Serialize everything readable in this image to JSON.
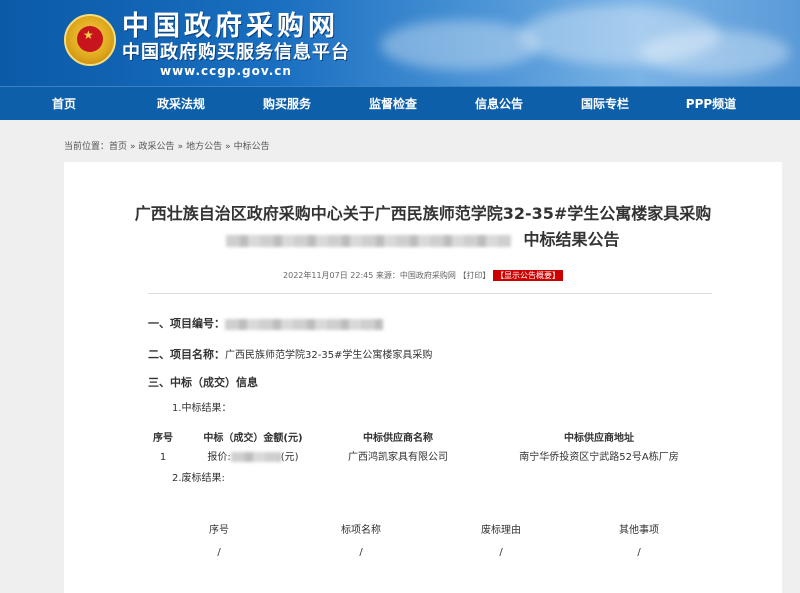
{
  "header": {
    "site_title": "中国政府采购网",
    "site_subtitle": "中国政府购买服务信息平台",
    "site_url": "www.ccgp.gov.cn"
  },
  "nav": [
    "首页",
    "政采法规",
    "购买服务",
    "监督检查",
    "信息公告",
    "国际专栏",
    "PPP频道"
  ],
  "breadcrumb": {
    "prefix": "当前位置：",
    "items": [
      "首页",
      "政采公告",
      "地方公告",
      "中标公告"
    ],
    "separator": "»"
  },
  "article": {
    "title_line1": "广西壮族自治区政府采购中心关于广西民族师范学院32-35#学生公寓楼家具采购",
    "title_line2_suffix": "中标结果公告",
    "meta": {
      "datetime": "2022年11月07日 22:45",
      "source": "来源：中国政府采购网",
      "print": "【打印】",
      "show_notice": "【显示公告概要】"
    },
    "sections": {
      "s1_label": "一、项目编号：",
      "s2_label": "二、项目名称：",
      "s2_value": "广西民族师范学院32-35#学生公寓楼家具采购",
      "s3_label": "三、中标（成交）信息"
    },
    "result": {
      "label": "1.中标结果：",
      "headers": [
        "序号",
        "中标（成交）金额(元)",
        "中标供应商名称",
        "中标供应商地址"
      ],
      "rows": [
        {
          "no": "1",
          "amount_prefix": "报价:",
          "amount_suffix": "(元)",
          "supplier": "广西鸿凯家具有限公司",
          "address": "南宁华侨投资区宁武路52号A栋厂房"
        }
      ]
    },
    "abandoned": {
      "label": "2.废标结果:",
      "headers": [
        "序号",
        "标项名称",
        "废标理由",
        "其他事项"
      ],
      "rows": [
        [
          "/",
          "/",
          "/",
          "/"
        ]
      ]
    }
  }
}
